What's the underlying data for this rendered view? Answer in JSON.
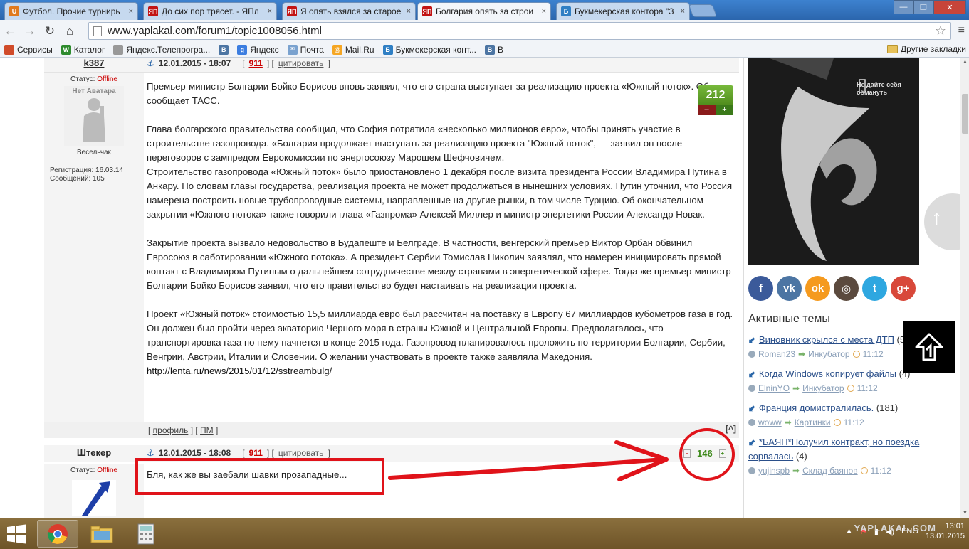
{
  "browser": {
    "tabs": [
      {
        "title": "Футбол. Прочие турнирь",
        "fav_color": "#e07a1e",
        "fav_text": "U",
        "active": false
      },
      {
        "title": "До сих пор трясет. - ЯПл",
        "fav_color": "#c21414",
        "fav_text": "ЯП",
        "active": false
      },
      {
        "title": "Я опять взялся за старое",
        "fav_color": "#c21414",
        "fav_text": "ЯП",
        "active": false
      },
      {
        "title": "Болгария опять за строи",
        "fav_color": "#c21414",
        "fav_text": "ЯП",
        "active": true
      },
      {
        "title": "Букмекерская контора \"З",
        "fav_color": "#2f7fc4",
        "fav_text": "Б",
        "active": false
      }
    ],
    "url": "www.yaplakal.com/forum1/topic1008056.html",
    "url_host": "www.yaplakal.com",
    "url_path": "/forum1/topic1008056.html",
    "bookmarks": [
      {
        "label": "Сервисы",
        "icon": "apps-icon",
        "color": "#d04b2a"
      },
      {
        "label": "Каталог",
        "icon": "w-icon",
        "color": "#2e8b2e",
        "glyph": "W"
      },
      {
        "label": "Яндекс.Телепрогра...",
        "icon": "page-icon",
        "color": "#999999"
      },
      {
        "label": "",
        "icon": "vk-icon",
        "color": "#4c75a3",
        "glyph": "B"
      },
      {
        "label": "Яндекс",
        "icon": "g-icon",
        "color": "#3b7de0",
        "glyph": "g"
      },
      {
        "label": "Почта",
        "icon": "mail-icon",
        "color": "#7aa2cf",
        "glyph": "✉"
      },
      {
        "label": "Mail.Ru",
        "icon": "mailru-icon",
        "color": "#f5a623",
        "glyph": "@"
      },
      {
        "label": "Букмекерская конт...",
        "icon": "bookmaker-icon",
        "color": "#2f7fc4",
        "glyph": "Б"
      },
      {
        "label": "B",
        "icon": "vk-icon",
        "color": "#4c75a3",
        "glyph": "B"
      }
    ],
    "other_bookmarks": "Другие закладки"
  },
  "post1": {
    "author": "k387",
    "status_label": "Статус:",
    "status_value": "Offline",
    "no_avatar": "Нет Аватара",
    "rank": "Весельчак",
    "reg_label": "Регистрация: 16.03.14",
    "msgs_label": "Сообщений: 105",
    "date": "12.01.2015 - 18:07",
    "post_number": "911",
    "quote": "цитировать",
    "rating": "212",
    "minus": "–",
    "plus": "+",
    "paragraphs": [
      "Премьер-министр Болгарии Бойко Борисов вновь заявил, что его страна выступает за реализацию проекта «Южный поток». Об этом сообщает ТАСС.",
      "Глава болгарского правительства сообщил, что София потратила «несколько миллионов евро», чтобы принять участие в строительстве газопровода. «Болгария продолжает выступать за реализацию проекта \"Южный поток\", — заявил он после переговоров с зампредом Еврокомиссии по энергосоюзу Марошем Шефчовичем.\nСтроительство газопровода «Южный поток» было приостановлено 1 декабря после визита президента России Владимира Путина в Анкару. По словам главы государства, реализация проекта не может продолжаться в нынешних условиях. Путин уточнил, что Россия намерена построить новые трубопроводные системы, направленные на другие рынки, в том числе Турцию. Об окончательном закрытии «Южного потока» также говорили глава «Газпрома» Алексей Миллер и министр энергетики России Александр Новак.",
      "Закрытие проекта вызвало недовольство в Будапеште и Белграде. В частности, венгерский премьер Виктор Орбан обвинил Евросоюз в саботировании «Южного потока». А президент Сербии Томислав Николич заявлял, что намерен инициировать прямой контакт с Владимиром Путиным о дальнейшем сотрудничестве между странами в энергетической сфере. Тогда же премьер-министр Болгарии Бойко Борисов заявил, что его правительство будет настаивать на реализации проекта.",
      "Проект «Южный поток» стоимостью 15,5 миллиарда евро был рассчитан на поставку в Европу 67 миллиардов кубометров газа в год. Он должен был пройти через акваторию Черного моря в страны Южной и Центральной Европы. Предполагалось, что транспортировка газа по нему начнется в конце 2015 года. Газопровод планировалось проложить по территории Болгарии, Сербии, Венгрии, Австрии, Италии и Словении. О желании участвовать в проекте также заявляла Македония."
    ],
    "link": "http://lenta.ru/news/2015/01/12/sstreambulg/",
    "profile": "профиль",
    "pm": "ПМ",
    "top": "[^]"
  },
  "post2": {
    "author": "Штекер",
    "status_label": "Статус:",
    "status_value": "Offline",
    "date": "12.01.2015 - 18:08",
    "post_number": "911",
    "quote": "цитировать",
    "rating": "146",
    "text": "Бля, как же вы заебали шавки прозападные..."
  },
  "sidebar": {
    "ad_text": "Не дайте себя обмануть",
    "socials": [
      {
        "name": "facebook-icon",
        "glyph": "f",
        "color": "#3b5a9a"
      },
      {
        "name": "vk-icon",
        "glyph": "vk",
        "color": "#4c75a3"
      },
      {
        "name": "odnoklassniki-icon",
        "glyph": "ok",
        "color": "#f59a1e"
      },
      {
        "name": "instagram-icon",
        "glyph": "◎",
        "color": "#5b4a3e"
      },
      {
        "name": "twitter-icon",
        "glyph": "t",
        "color": "#2ea7e0"
      },
      {
        "name": "googleplus-icon",
        "glyph": "g+",
        "color": "#d8483a"
      }
    ],
    "active_topics_title": "Активные темы",
    "topics": [
      {
        "title": "Виновник скрылся с места ДТП",
        "count": "(5)",
        "user": "Roman23",
        "section": "Инкубатор",
        "time": "11:12"
      },
      {
        "title": "Когда Windows копирует файлы",
        "count": "(4)",
        "user": "ElninYO",
        "section": "Инкубатор",
        "time": "11:12"
      },
      {
        "title": "Франция домистралилась.",
        "count": "(181)",
        "user": "woww",
        "section": "Картинки",
        "time": "11:12"
      },
      {
        "title": "*БАЯН*Получил контракт, но поездка сорвалась",
        "count": "(4)",
        "user": "yujinspb",
        "section": "Склад баянов",
        "time": "11:12"
      }
    ]
  },
  "taskbar": {
    "lang": "ENG",
    "time": "13:01",
    "date": "13.01.2015",
    "watermark": "YAPLAKAL.COM"
  }
}
